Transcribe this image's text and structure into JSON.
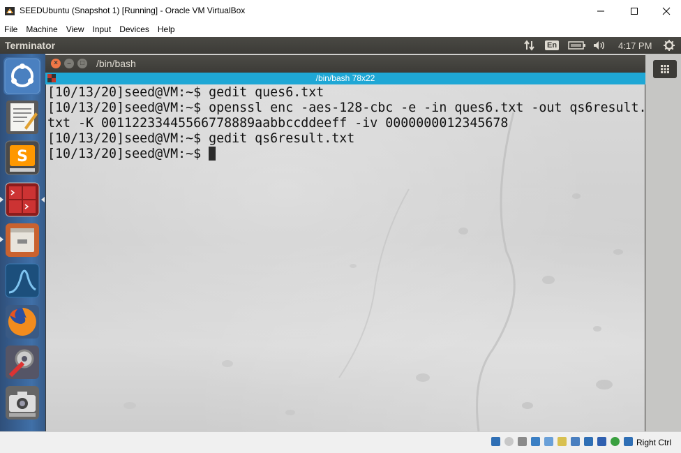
{
  "host_window": {
    "title": "SEEDUbuntu (Snapshot 1) [Running] - Oracle VM VirtualBox",
    "controls": [
      "minimize-icon",
      "maximize-icon",
      "close-icon"
    ]
  },
  "vbox_menu": [
    "File",
    "Machine",
    "View",
    "Input",
    "Devices",
    "Help"
  ],
  "ubuntu_panel": {
    "app_title": "Terminator",
    "keyboard_layout": "En",
    "clock": "4:17 PM",
    "indicators": [
      "network-transfer-icon",
      "battery-icon",
      "volume-icon",
      "settings-gear-icon"
    ]
  },
  "launcher": {
    "items": [
      {
        "name": "ubuntu-dash-icon"
      },
      {
        "name": "text-editor-icon"
      },
      {
        "name": "sublime-text-icon"
      },
      {
        "name": "terminator-icon"
      },
      {
        "name": "file-manager-icon"
      },
      {
        "name": "wireshark-icon"
      },
      {
        "name": "firefox-icon"
      },
      {
        "name": "system-settings-icon"
      },
      {
        "name": "screenshot-camera-icon"
      }
    ]
  },
  "terminal": {
    "window_title": "/bin/bash",
    "tab_title": "/bin/bash 78x22",
    "lines": [
      "[10/13/20]seed@VM:~$ gedit ques6.txt",
      "[10/13/20]seed@VM:~$ openssl enc -aes-128-cbc -e -in ques6.txt -out qs6result.",
      "txt -K 00112233445566778889aabbccddeeff -iv 0000000012345678",
      "[10/13/20]seed@VM:~$ gedit qs6result.txt",
      "[10/13/20]seed@VM:~$ "
    ]
  },
  "statusbar": {
    "host_key": "Right Ctrl",
    "icons": [
      "hard-disk-icon",
      "optical-drive-icon",
      "audio-icon",
      "network-icon",
      "usb-icon",
      "shared-folders-icon",
      "display-icon",
      "video-capture-icon",
      "recording-icon",
      "virtualization-icon",
      "cpu-icon",
      "mouse-integration-icon"
    ]
  },
  "colors": {
    "ubuntu_panel": "#3c3b37",
    "terminal_tab": "#1fa7d5",
    "close_button": "#f07746",
    "launcher": "#3a6496"
  }
}
